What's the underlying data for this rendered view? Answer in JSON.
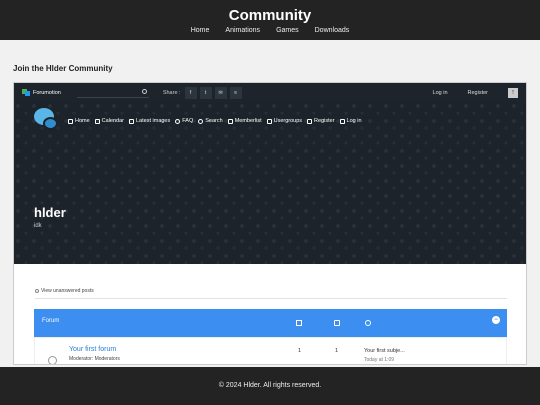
{
  "site": {
    "title": "Community",
    "nav": [
      "Home",
      "Animations",
      "Games",
      "Downloads"
    ]
  },
  "join_heading": "Join the Hlder Community",
  "forum_embed": {
    "topbar": {
      "brand": "Forumotion",
      "share_label": "Share :",
      "share_buttons": [
        "f",
        "t",
        "✉",
        "≡"
      ],
      "login": "Log in",
      "register": "Register",
      "up_icon": "arrow-up-icon"
    },
    "hero_nav": [
      {
        "label": "Home",
        "icon": "home-icon"
      },
      {
        "label": "Calendar",
        "icon": "calendar-icon"
      },
      {
        "label": "Latest images",
        "icon": "image-icon"
      },
      {
        "label": "FAQ",
        "icon": "question-icon"
      },
      {
        "label": "Search",
        "icon": "search-icon"
      },
      {
        "label": "Memberlist",
        "icon": "members-icon"
      },
      {
        "label": "Usergroups",
        "icon": "usergroups-icon"
      },
      {
        "label": "Register",
        "icon": "register-icon"
      },
      {
        "label": "Log in",
        "icon": "login-icon"
      }
    ],
    "forum_name": "hlder",
    "forum_description": "idk",
    "unanswered_link": "View unanswered posts",
    "category": {
      "title": "Forum",
      "collapse_symbol": "−",
      "column_icons": [
        "topics-icon",
        "posts-icon",
        "clock-icon"
      ],
      "rows": [
        {
          "title": "Your first forum",
          "moderators": "Moderator: Moderators",
          "topics": "1",
          "posts": "1",
          "last_post": "Your first subje...",
          "last_post_date": "Today at 1:09"
        }
      ]
    }
  },
  "footer": "© 2024 Hlder. All rights reserved.",
  "colors": {
    "header_bg": "#232323",
    "accent_blue": "#3c8ef1",
    "hero_bg": "#1c232b"
  }
}
